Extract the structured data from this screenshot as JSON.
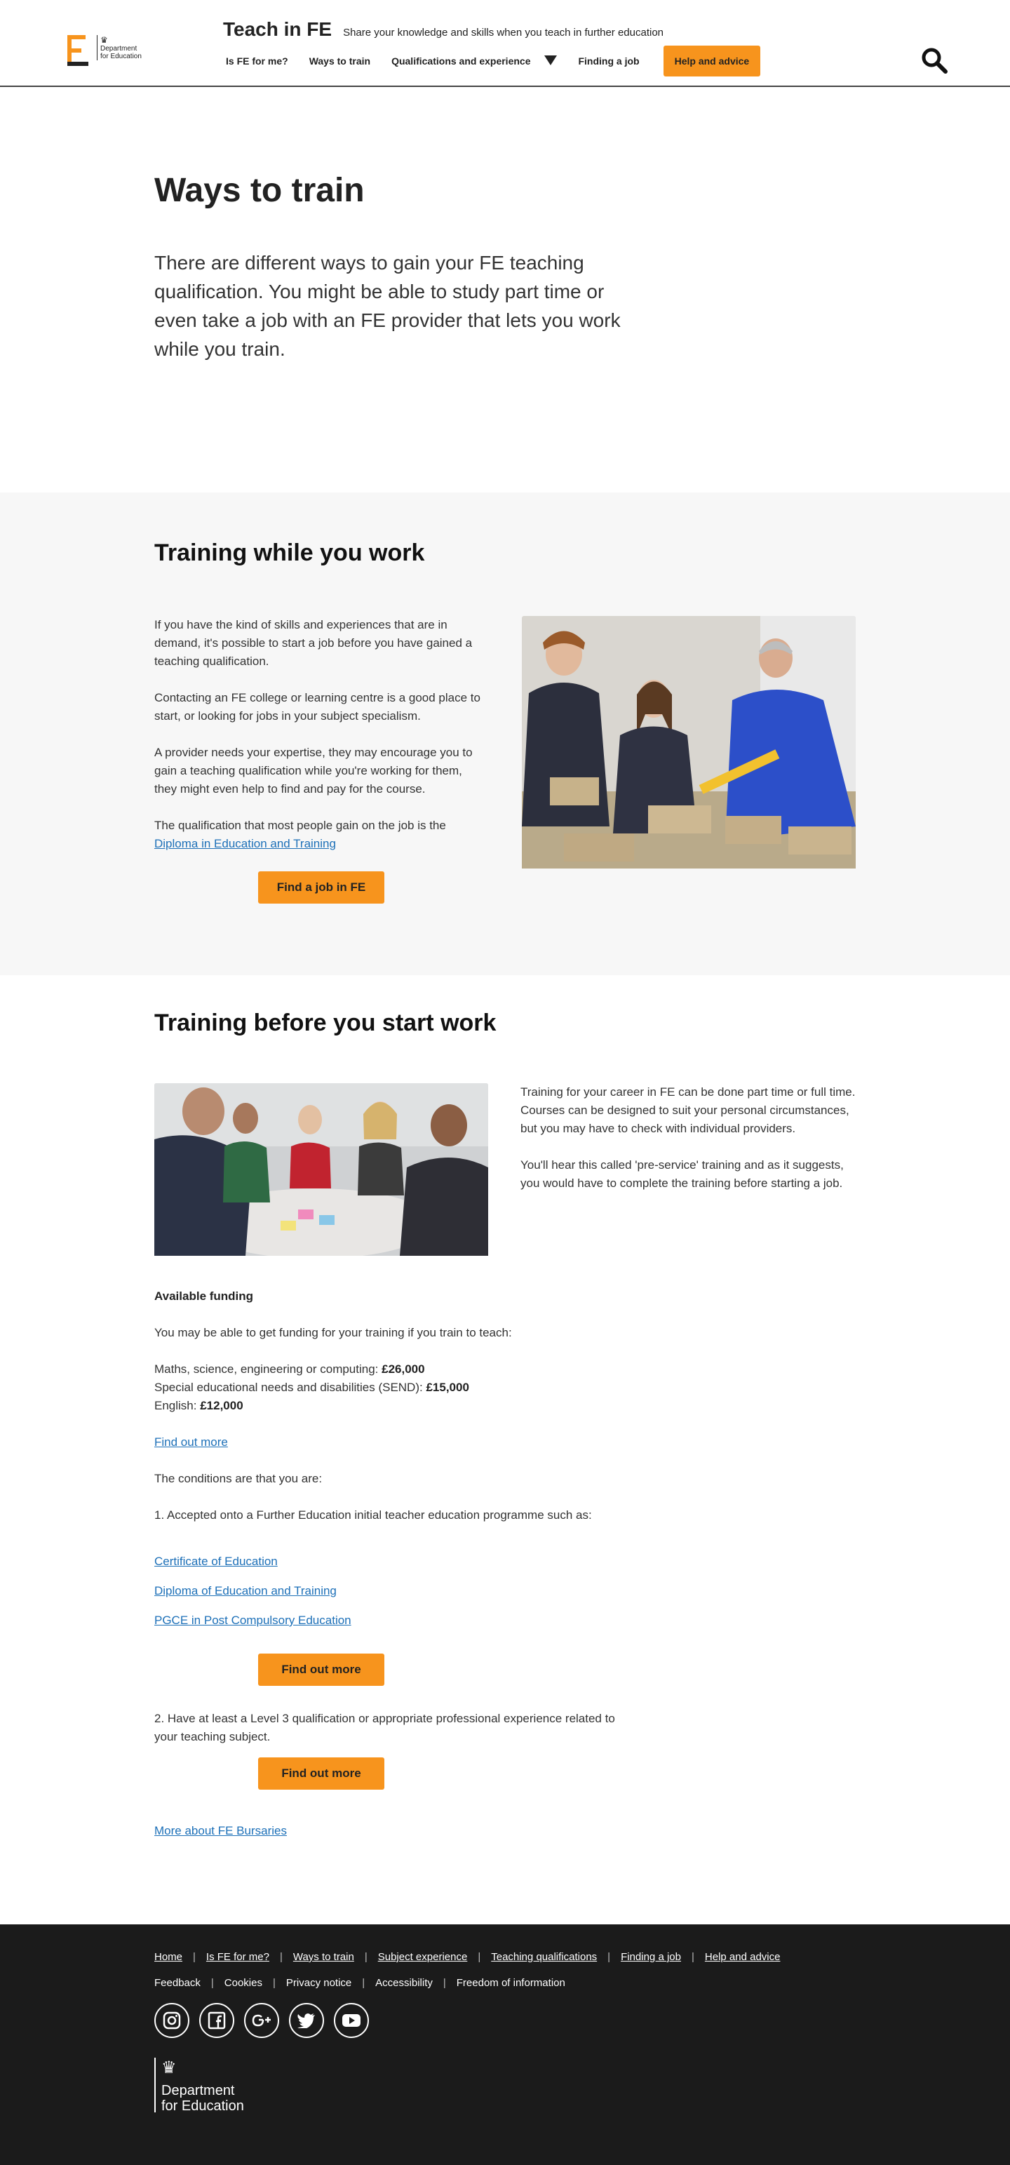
{
  "header": {
    "logo_text": "Department for Education",
    "site_name": "Teach in FE",
    "tagline": "Share your knowledge and skills when you teach in further education",
    "nav": [
      {
        "label": "Is FE for me?"
      },
      {
        "label": "Ways to train"
      },
      {
        "label": "Qualifications and experience"
      },
      {
        "label": "Finding a job"
      }
    ],
    "help_button": "Help and advice",
    "icons": {
      "search": "search-icon",
      "dropdown": "chevron-down-icon"
    }
  },
  "hero": {
    "title": "Ways to train",
    "intro": "There are different ways to gain your FE teaching qualification. You might be able to study part time or even take a job with an FE provider that lets you work while you train."
  },
  "training_while_work": {
    "heading": "Training while you work",
    "paragraphs": [
      "If you have the kind of skills and experiences that are in demand, it's possible to start a job before you have gained a teaching qualification.",
      "Contacting an FE college or learning centre is a good place to start, or looking for jobs in your subject specialism.",
      "A provider needs your expertise, they may encourage you to gain a teaching qualification while you're working for them, they might even help to find and pay for the course."
    ],
    "qualification_text": "The qualification that most people gain on the job is the",
    "qualification_link": "Diploma in Education and Training",
    "button": "Find a job in FE"
  },
  "training_before_work": {
    "heading": "Training before you start work",
    "paragraphs": [
      "Training for your career in FE can be done part time or full time. Courses can be designed to suit your personal circumstances, but you may have to check with individual providers.",
      "You'll hear this called 'pre-service' training and as it suggests, you would have to complete the training before starting a job."
    ],
    "funding_heading": "Available funding",
    "funding_intro": "You may be able to get funding for your training if you train to teach:",
    "funding_items": [
      {
        "label": "Maths, science, engineering or computing: ",
        "amount": "£26,000"
      },
      {
        "label": "Special educational needs and disabilities (SEND): ",
        "amount": "£15,000"
      },
      {
        "label": "English: ",
        "amount": "£12,000"
      }
    ],
    "find_out_more_link": "Find out more",
    "conditions_intro": "The conditions are that you are:",
    "condition_1": "1. Accepted onto a Further Education initial teacher education programme such as:",
    "programme_links": [
      "Certificate of Education",
      "Diploma of Education and Training",
      "PGCE in Post Compulsory Education"
    ],
    "button_1": "Find out more",
    "condition_2": "2. Have at least a Level 3 qualification or appropriate professional experience related to your teaching subject.",
    "button_2": "Find out more",
    "bursaries_link": "More about FE Bursaries"
  },
  "footer": {
    "links_row1": [
      "Home",
      "Is FE for me?",
      "Ways to train",
      "Subject experience",
      "Teaching qualifications",
      "Finding a job",
      "Help and advice"
    ],
    "links_row2": [
      "Feedback",
      "Cookies",
      "Privacy notice",
      "Accessibility",
      "Freedom of information"
    ],
    "social_icons": [
      "instagram-icon",
      "facebook-icon",
      "google-plus-icon",
      "twitter-icon",
      "youtube-icon"
    ],
    "logo_line1": "Department",
    "logo_line2": "for Education"
  },
  "colors": {
    "accent": "#f7941d",
    "link": "#1d70b8",
    "footer_bg": "#1b1b1b",
    "section_grey": "#f7f7f7"
  }
}
